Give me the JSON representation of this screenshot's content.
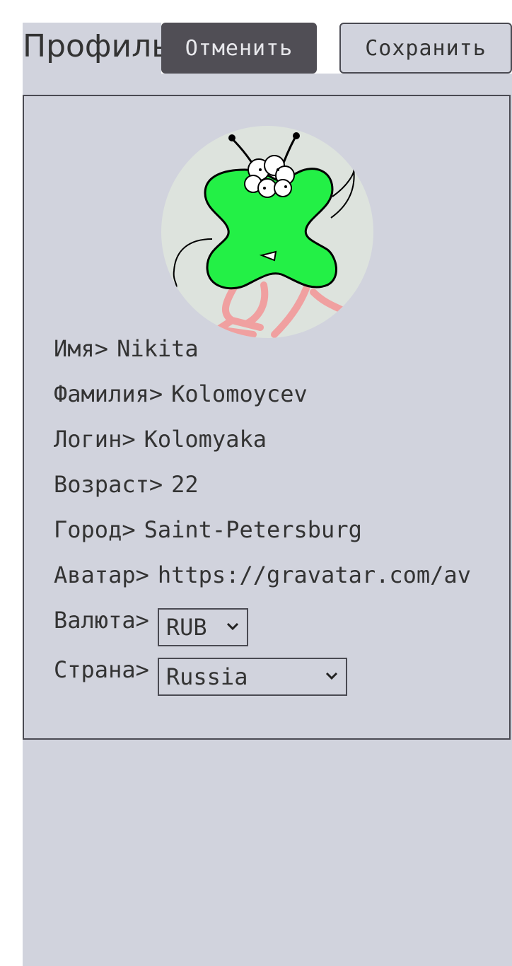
{
  "header": {
    "title": "Профиль",
    "cancel_label": "Отменить",
    "save_label": "Сохранить"
  },
  "profile": {
    "fields": [
      {
        "label": "Имя>",
        "value": "Nikita"
      },
      {
        "label": "Фамилия>",
        "value": "Kolomoycev"
      },
      {
        "label": "Логин>",
        "value": "Kolomyaka"
      },
      {
        "label": "Возраст>",
        "value": "22"
      },
      {
        "label": "Город>",
        "value": "Saint-Petersburg"
      },
      {
        "label": "Аватар>",
        "value": "https://gravatar.com/av"
      }
    ],
    "currency": {
      "label": "Валюта>",
      "value": "RUB"
    },
    "country": {
      "label": "Страна>",
      "value": "Russia"
    }
  },
  "icons": {
    "avatar": "avatar-image",
    "select_arrow": "chevron-down-icon"
  },
  "colors": {
    "page_bg": "#d1d3dd",
    "cancel_bg": "#504e55",
    "text": "#333333",
    "avatar_green": "#23f046",
    "avatar_pink": "#f0a0a0"
  }
}
